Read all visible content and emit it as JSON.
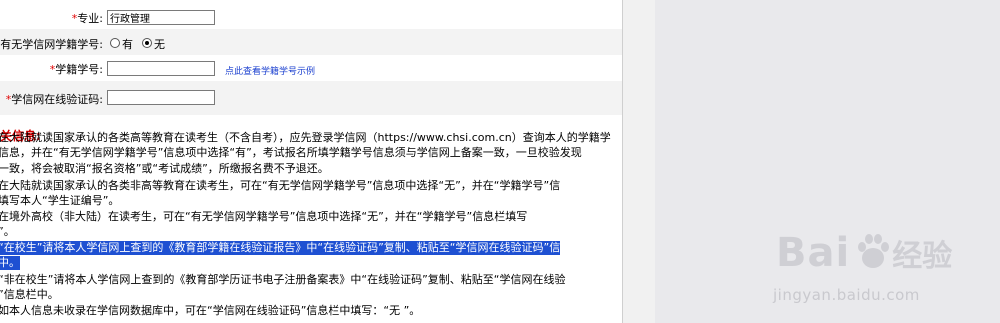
{
  "form": {
    "major": {
      "required_mark": "*",
      "label": "专业:",
      "value": "行政管理"
    },
    "has_xuexin": {
      "label": "有无学信网学籍学号:",
      "option_yes": "有",
      "option_no": "无",
      "selected": "无"
    },
    "student_id": {
      "required_mark": "*",
      "label": "学籍学号:",
      "value": "",
      "example_link": "点此查看学籍学号示例"
    },
    "verify_code": {
      "required_mark": "*",
      "label": "学信网在线验证码:",
      "value": ""
    }
  },
  "notes": {
    "header": "关信息:",
    "lines": [
      "在大陆就读国家承认的各类高等教育在读考生（不含自考），应先登录学信网（https://www.chsi.com.cn）查询本人的学籍学",
      "信息，并在“有无学信网学籍学号”信息项中选择“有”，考试报名所填学籍学号信息须与学信网上备案一致，一旦校验发现",
      "一致，将会被取消“报名资格”或“考试成绩”，所缴报名费不予退还。",
      "在大陆就读国家承认的各类非高等教育在读考生，可在“有无学信网学籍学号”信息项中选择“无”，并在“学籍学号”信",
      "填写本人“学生证编号”。",
      "在境外高校（非大陆）在读考生，可在“有无学信网学籍学号”信息项中选择“无”，并在“学籍学号”信息栏填写",
      "”。",
      "“在校生”请将本人学信网上查到的《教育部学籍在线验证报告》中“在线验证码”复制、粘贴至“学信网在线验证码”信",
      "中。",
      "“非在校生”请将本人学信网上查到的《教育部学历证书电子注册备案表》中“在线验证码”复制、粘贴至“学信网在线验",
      "”信息栏中。",
      "如本人信息未收录在学信网数据库中，可在“学信网在线验证码”信息栏中填写：“无 ”。"
    ]
  },
  "watermark": {
    "brand": "Bai",
    "brand_suffix": "经验",
    "url": "jingyan.baidu.com"
  },
  "colors": {
    "required": "#e00000",
    "link": "#1a3fcf",
    "highlight": "#1e50d2",
    "right_panel": "#e9e9ec"
  }
}
